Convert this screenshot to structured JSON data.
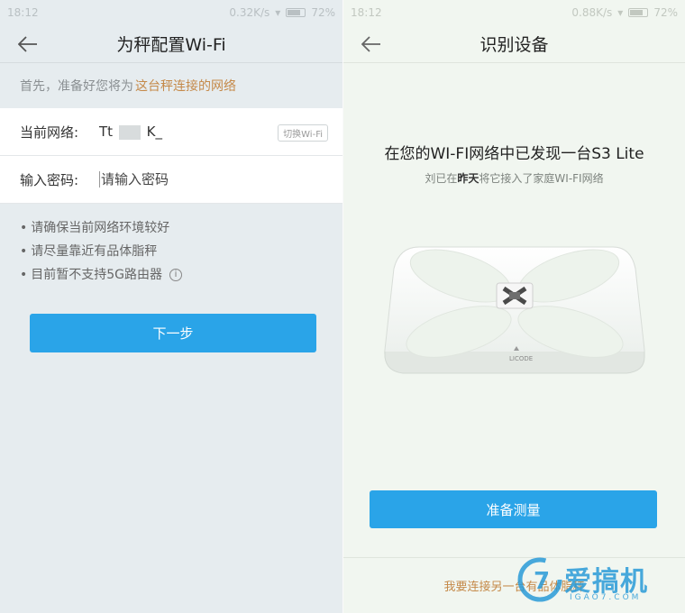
{
  "left": {
    "status": {
      "time": "18:12",
      "speed": "0.32K/s",
      "battery": "72%"
    },
    "title": "为秤配置Wi-Fi",
    "prep_text": "首先，准备好您将为",
    "prep_link": "这台秤连接的网络",
    "network_label": "当前网络:",
    "network_value_prefix": "Tt",
    "network_value_suffix": "K_",
    "switch_wifi": "切换Wi-Fi",
    "password_label": "输入密码:",
    "password_placeholder": "请输入密码",
    "tips": [
      "请确保当前网络环境较好",
      "请尽量靠近有品体脂秤",
      "目前暂不支持5G路由器"
    ],
    "next_button": "下一步"
  },
  "right": {
    "status": {
      "time": "18:12",
      "speed": "0.88K/s",
      "battery": "72%"
    },
    "title": "识别设备",
    "found_title": "在您的WI-FI网络中已发现一台S3 Lite",
    "found_sub_prefix": "刘已在",
    "found_sub_bold": "昨天",
    "found_sub_suffix": "将它接入了家庭WI-FI网络",
    "device_brand": "LICODE",
    "ready_button": "准备测量",
    "bottom_link": "我要连接另一台有品体脂秤"
  },
  "watermark": {
    "brand": "爱搞机",
    "site": "IGAO7.COM",
    "badge": "7"
  },
  "colors": {
    "accent_blue": "#2aa4e8",
    "link_orange": "#c58a4a"
  }
}
